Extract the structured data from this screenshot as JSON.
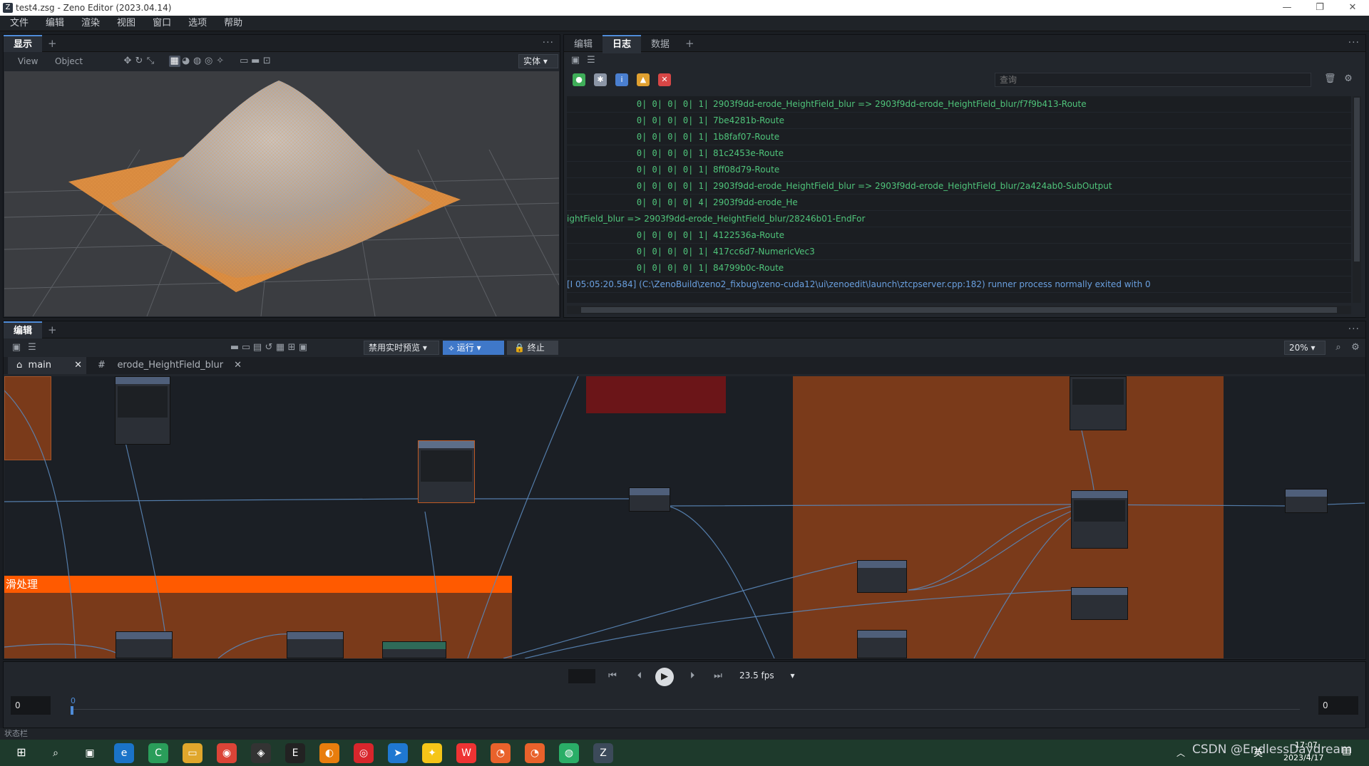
{
  "window": {
    "title": "test4.zsg - Zeno Editor (2023.04.14)",
    "minimize": "—",
    "restore": "❐",
    "close": "✕"
  },
  "menu": [
    "文件",
    "编辑",
    "渲染",
    "视图",
    "窗口",
    "选项",
    "帮助"
  ],
  "viewport": {
    "tab": "显示",
    "toolbar": {
      "view": "View",
      "object": "Object",
      "mode": "实体"
    }
  },
  "right_panel": {
    "tabs": [
      "编辑",
      "日志",
      "数据"
    ],
    "active_tab": "日志",
    "search_placeholder": "查询",
    "log_rows": [
      {
        "cols": "0|     0|     0|     0|     1|",
        "text": "2903f9dd-erode_HeightField_blur => 2903f9dd-erode_HeightField_blur/f7f9b413-Route"
      },
      {
        "cols": "0|     0|     0|     0|     1|",
        "text": "7be4281b-Route"
      },
      {
        "cols": "0|     0|     0|     0|     1|",
        "text": "1b8faf07-Route"
      },
      {
        "cols": "0|     0|     0|     0|     1|",
        "text": "81c2453e-Route"
      },
      {
        "cols": "0|     0|     0|     0|     1|",
        "text": "8ff08d79-Route"
      },
      {
        "cols": "0|     0|     0|     0|     1|",
        "text": "2903f9dd-erode_HeightField_blur => 2903f9dd-erode_HeightField_blur/2a424ab0-SubOutput"
      },
      {
        "cols": "0|     0|     0|     0|     4|",
        "text": "2903f9dd-erode_He"
      },
      {
        "cols": "",
        "text": "ightField_blur => 2903f9dd-erode_HeightField_blur/28246b01-EndFor"
      },
      {
        "cols": "0|     0|     0|     0|     1|",
        "text": "4122536a-Route"
      },
      {
        "cols": "0|     0|     0|     0|     1|",
        "text": "417cc6d7-NumericVec3"
      },
      {
        "cols": "0|     0|     0|     0|     1|",
        "text": "84799b0c-Route"
      }
    ],
    "info_line": "[I 05:05:20.584] (C:\\ZenoBuild\\zeno2_fixbug\\zeno-cuda12\\ui\\zenoedit\\launch\\ztcpserver.cpp:182) runner process normally exited with 0"
  },
  "editor": {
    "tab": "编辑",
    "realtime": "禁用实时预览",
    "run": "运行",
    "stop": "终止",
    "zoom": "20%",
    "graph_tabs": [
      "main",
      "erode_HeightField_blur"
    ],
    "group_title": "滑处理"
  },
  "timeline": {
    "fps": "23.5 fps",
    "start": "0",
    "end": "0",
    "marker": "0"
  },
  "statusbar": {
    "text": "状态栏"
  },
  "taskbar": {
    "watermark": "CSDN @EndlessDaydream",
    "time": "17:07",
    "date": "2023/4/17",
    "ime": "英"
  },
  "colors": {
    "accent": "#4f8cd8",
    "group": "#7a3a1a",
    "group_header": "#ff5a00",
    "log_green": "#4fc37a"
  }
}
